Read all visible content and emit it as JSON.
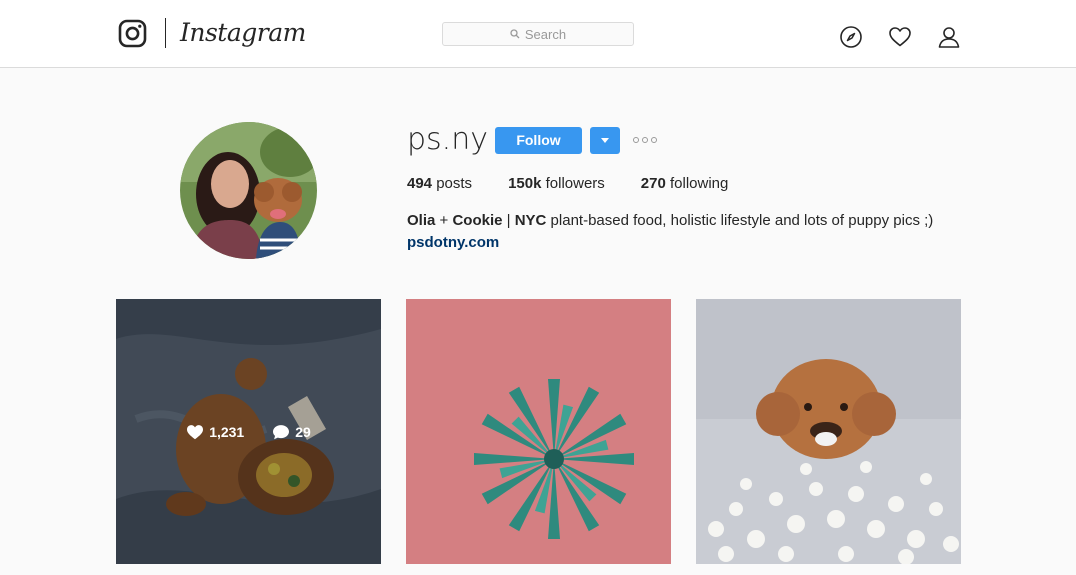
{
  "brand": {
    "wordmark": "Instagram"
  },
  "search": {
    "placeholder": "Search"
  },
  "nav": {
    "icons": [
      "compass-icon",
      "heart-icon",
      "user-icon"
    ]
  },
  "profile": {
    "username": "ps.ny",
    "follow_label": "Follow",
    "stats": {
      "posts_count": "494",
      "posts_label": "posts",
      "followers_count": "150k",
      "followers_label": "followers",
      "following_count": "270",
      "following_label": "following"
    },
    "bio": {
      "name_part1": "Olia",
      "plus": " + ",
      "name_part2": "Cookie",
      "sep": " | ",
      "city": "NYC",
      "text": " plant-based food, holistic lifestyle and lots of puppy pics ;)",
      "link": "psdotny.com"
    }
  },
  "posts": [
    {
      "id": "post-1",
      "likes": "1,231",
      "comments": "29",
      "hovered": true
    },
    {
      "id": "post-2"
    },
    {
      "id": "post-3"
    }
  ],
  "colors": {
    "accent": "#3897f0",
    "link": "#003569",
    "border": "#dbdbdb",
    "bg": "#fafafa"
  }
}
